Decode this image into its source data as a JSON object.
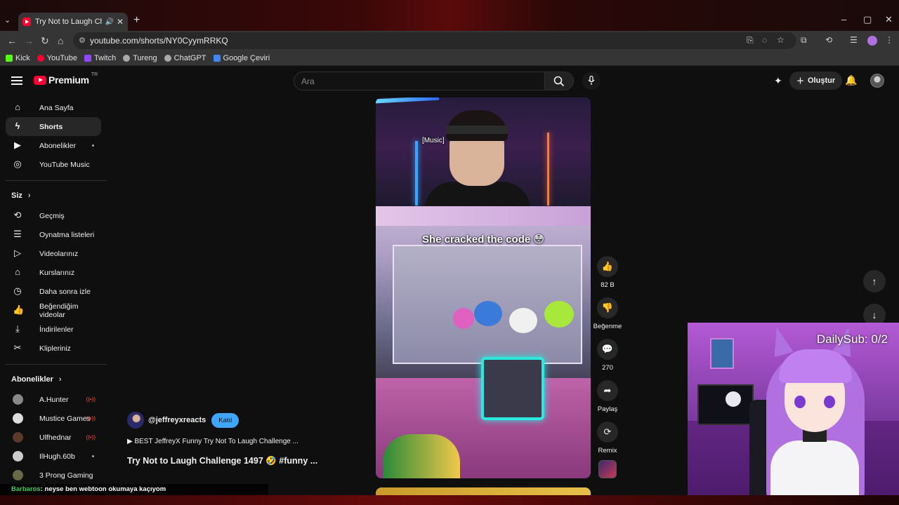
{
  "browser": {
    "tab_title": "Try Not to Laugh Challenge",
    "url": "youtube.com/shorts/NY0CyymRRKQ",
    "bookmarks": [
      {
        "label": "Kick",
        "color": "#53fc18"
      },
      {
        "label": "YouTube",
        "color": "#ff0033"
      },
      {
        "label": "Twitch",
        "color": "#9146ff"
      },
      {
        "label": "Tureng",
        "color": "#aaaaaa"
      },
      {
        "label": "ChatGPT",
        "color": "#aaaaaa"
      },
      {
        "label": "Google Çeviri",
        "color": "#4285f4"
      }
    ]
  },
  "header": {
    "logo_text": "Premium",
    "logo_region": "TR",
    "search_placeholder": "Ara",
    "create_label": "Oluştur"
  },
  "sidebar": {
    "main": [
      {
        "label": "Ana Sayfa",
        "icon": "home-icon"
      },
      {
        "label": "Shorts",
        "icon": "shorts-icon"
      },
      {
        "label": "Abonelikler",
        "icon": "subscriptions-icon"
      },
      {
        "label": "YouTube Music",
        "icon": "music-icon"
      }
    ],
    "you_title": "Siz",
    "you": [
      {
        "label": "Geçmiş",
        "icon": "history-icon"
      },
      {
        "label": "Oynatma listeleri",
        "icon": "playlist-icon"
      },
      {
        "label": "Videolarınız",
        "icon": "your-videos-icon"
      },
      {
        "label": "Kurslarınız",
        "icon": "courses-icon"
      },
      {
        "label": "Daha sonra izle",
        "icon": "watch-later-icon"
      },
      {
        "label": "Beğendiğim videolar",
        "icon": "liked-icon"
      },
      {
        "label": "İndirilenler",
        "icon": "download-icon"
      },
      {
        "label": "Klipleriniz",
        "icon": "clips-icon"
      }
    ],
    "subs_title": "Abonelikler",
    "subs": [
      {
        "label": "A.Hunter",
        "color": "#888888"
      },
      {
        "label": "Mustice Games",
        "color": "#dddddd"
      },
      {
        "label": "Ulfhednar",
        "color": "#5a3a2a"
      },
      {
        "label": "IlHugh.60b",
        "color": "#cccccc"
      },
      {
        "label": "3 Prong Gaming",
        "color": "#6a6a4a"
      }
    ]
  },
  "short": {
    "music_caption": "[Music]",
    "caption": "She cracked the code 😳",
    "channel": "@jeffreyxreacts",
    "join_label": "Katıl",
    "suggestion": "▶ BEST JeffreyX Funny Try Not To Laugh Challenge ...",
    "title": "Try Not to Laugh Challenge 1497 🤣 #funny ..."
  },
  "actions": {
    "likes": "82 B",
    "dislike_label": "Beğenme",
    "comments": "270",
    "share_label": "Paylaş",
    "remix_label": "Remix"
  },
  "overlay": {
    "daily_sub": "DailySub: 0/2"
  },
  "chat": {
    "user": "Barbaros",
    "message": ": neyse ben webtoon okumaya kaçıyom"
  }
}
